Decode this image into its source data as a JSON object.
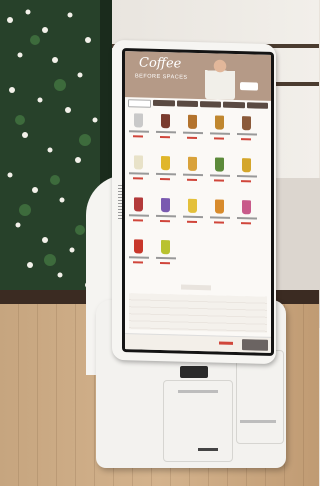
{
  "scene": {
    "subject": "self-order-kiosk",
    "colors": {
      "wall": "#efe9e2",
      "plants": "#27412a",
      "counter": "#c6a57f",
      "kiosk_body": "#f3f2ef",
      "screen_header": "#b59a87",
      "accent_price": "#d0463b"
    }
  },
  "screen": {
    "title_line1": "Coffee",
    "title_line2": "BEFORE SPACES",
    "products": [
      {
        "cup_color": "#c9c9c9"
      },
      {
        "cup_color": "#7a3b2e"
      },
      {
        "cup_color": "#b3732d"
      },
      {
        "cup_color": "#c0872f"
      },
      {
        "cup_color": "#8b5a3a"
      },
      {
        "cup_color": "#e8e2c8"
      },
      {
        "cup_color": "#e0b62a"
      },
      {
        "cup_color": "#d9a23a"
      },
      {
        "cup_color": "#5c8a3a"
      },
      {
        "cup_color": "#d4a62b"
      },
      {
        "cup_color": "#b33a3a"
      },
      {
        "cup_color": "#7a5ab0"
      },
      {
        "cup_color": "#e4c03a"
      },
      {
        "cup_color": "#d88b2c"
      },
      {
        "cup_color": "#c85a8a"
      },
      {
        "cup_color": "#c8372b"
      },
      {
        "cup_color": "#b9c22f"
      }
    ]
  }
}
